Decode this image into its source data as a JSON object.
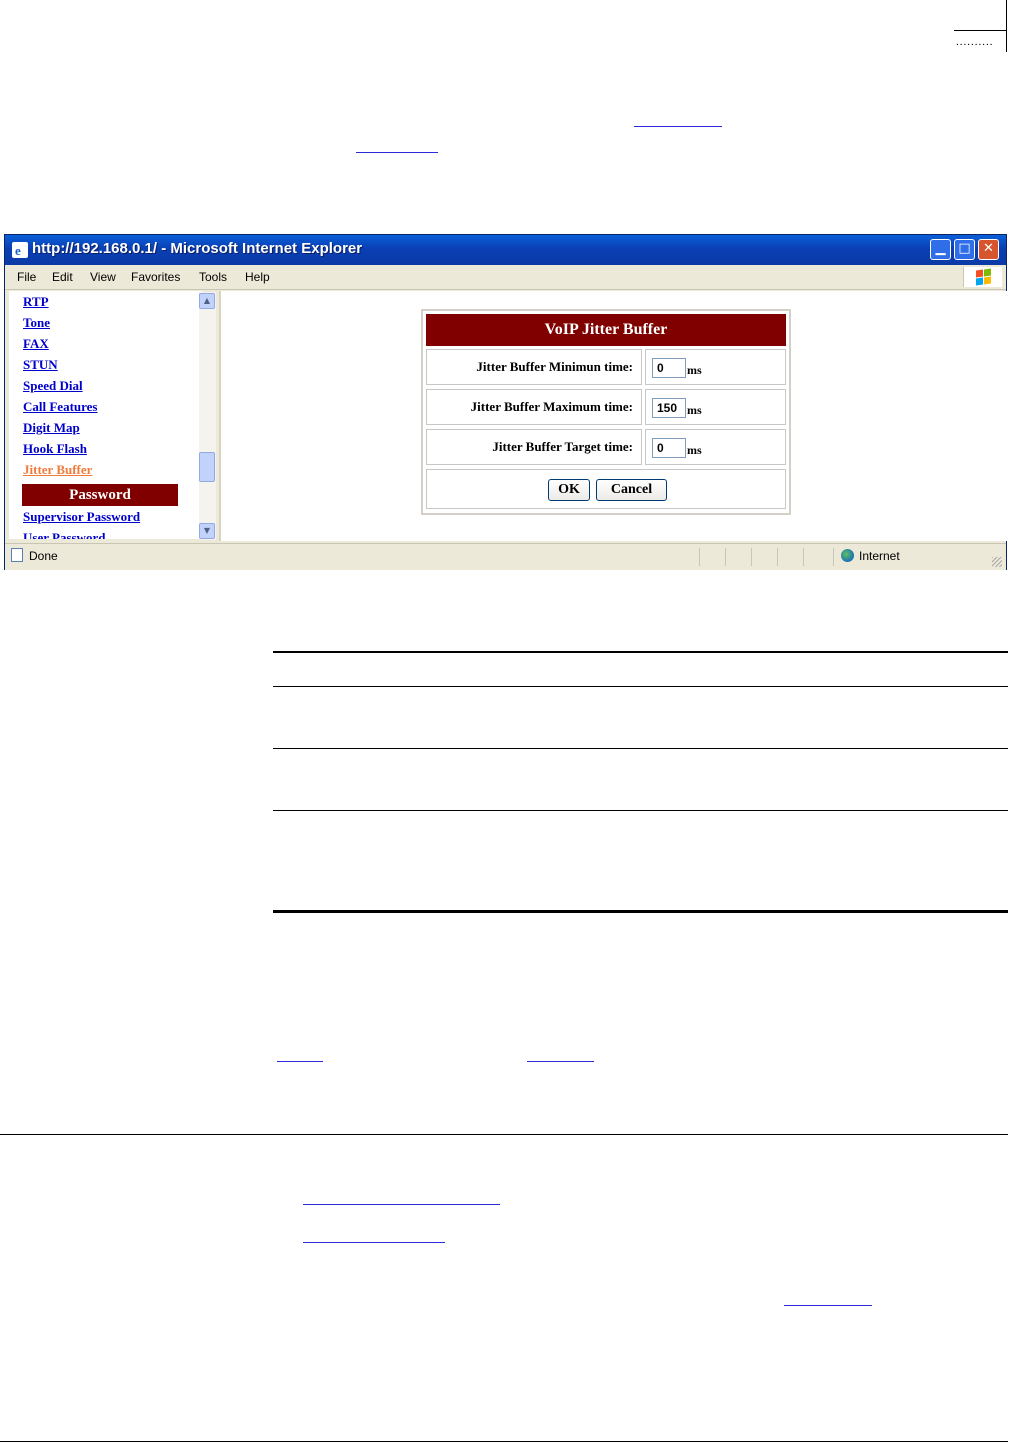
{
  "browser": {
    "title": "http://192.168.0.1/ - Microsoft Internet Explorer",
    "menu": [
      "File",
      "Edit",
      "View",
      "Favorites",
      "Tools",
      "Help"
    ],
    "status_left": "Done",
    "status_zone": "Internet"
  },
  "nav": {
    "links": [
      "RTP",
      "Tone",
      "FAX",
      "STUN",
      "Speed Dial",
      "Call Features",
      "Digit Map",
      "Hook Flash",
      "Jitter Buffer"
    ],
    "active": "Jitter Buffer",
    "section_header": "Password",
    "section_links": [
      "Supervisor Password",
      "User Password"
    ]
  },
  "panel": {
    "title": "VoIP Jitter Buffer",
    "rows": [
      {
        "label": "Jitter Buffer Minimun time:",
        "value": "0",
        "unit": "ms"
      },
      {
        "label": "Jitter Buffer Maximum time:",
        "value": "150",
        "unit": "ms"
      },
      {
        "label": "Jitter Buffer Target time:",
        "value": "0",
        "unit": "ms"
      }
    ],
    "ok_label": "OK",
    "cancel_label": "Cancel"
  },
  "colors": {
    "header_bg": "#800000",
    "link": "#0000cc",
    "active_link": "#f07b3a",
    "titlebar": "#0a4fc8"
  }
}
